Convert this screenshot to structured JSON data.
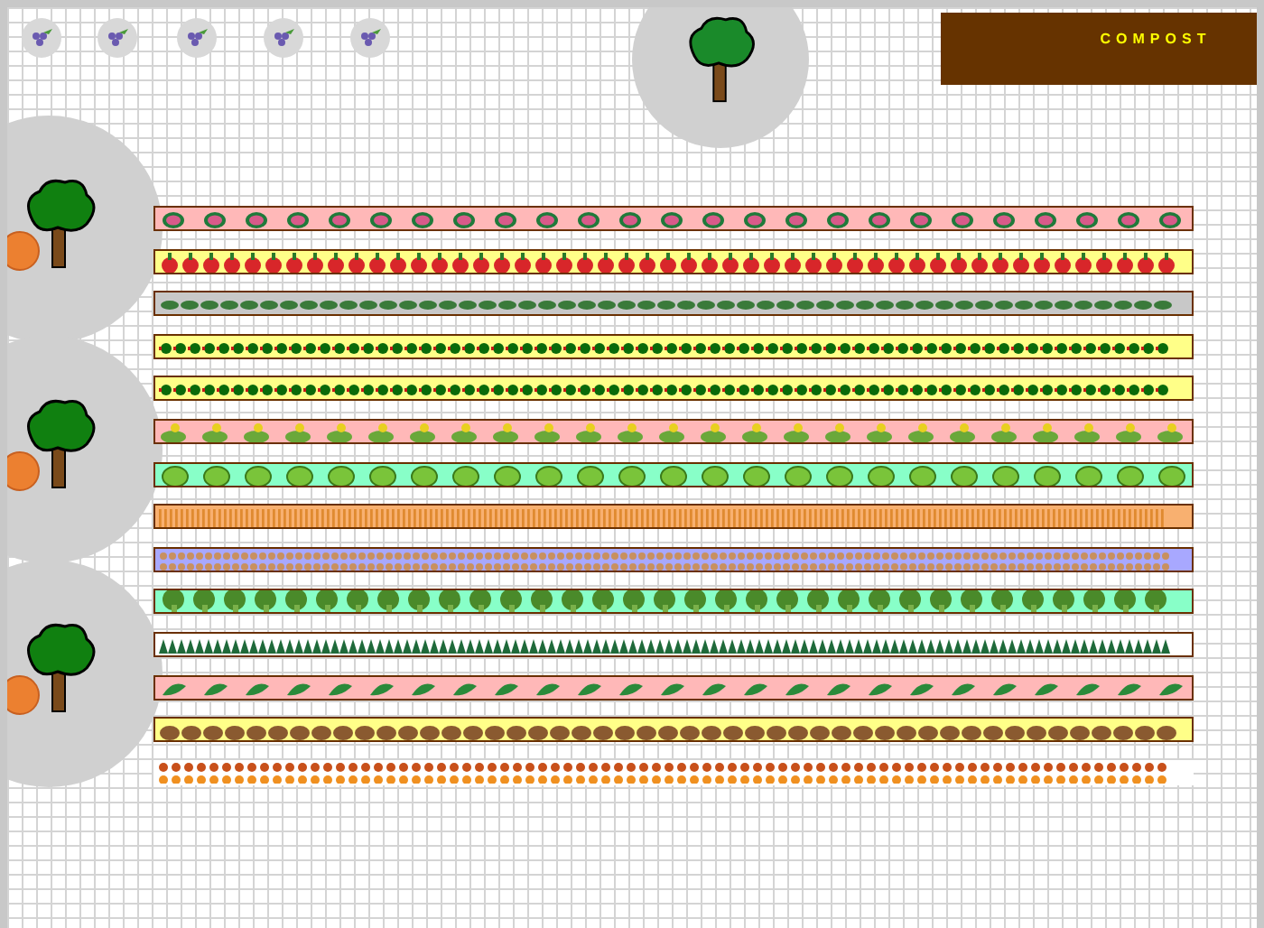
{
  "compost": {
    "label": "COMPOST"
  },
  "rows": [
    {
      "kind": "watermelon",
      "color": "#ffb8b8"
    },
    {
      "kind": "tomato",
      "color": "#ffff88"
    },
    {
      "kind": "leaf",
      "color": "#c8c8c8"
    },
    {
      "kind": "pepper",
      "color": "#ffff88"
    },
    {
      "kind": "pepper",
      "color": "#ffff88"
    },
    {
      "kind": "squash",
      "color": "#ffb8b8"
    },
    {
      "kind": "lettuce",
      "color": "#88ffc8"
    },
    {
      "kind": "carrot",
      "color": "#f8b070"
    },
    {
      "kind": "onion",
      "color": "#a8a8ff"
    },
    {
      "kind": "broccoli",
      "color": "#88ffc8"
    },
    {
      "kind": "kale",
      "color": "#ffffff"
    },
    {
      "kind": "pea",
      "color": "#ffb8b8"
    },
    {
      "kind": "potato",
      "color": "#ffff88"
    },
    {
      "kind": "flower",
      "color": "#ffffff"
    }
  ]
}
